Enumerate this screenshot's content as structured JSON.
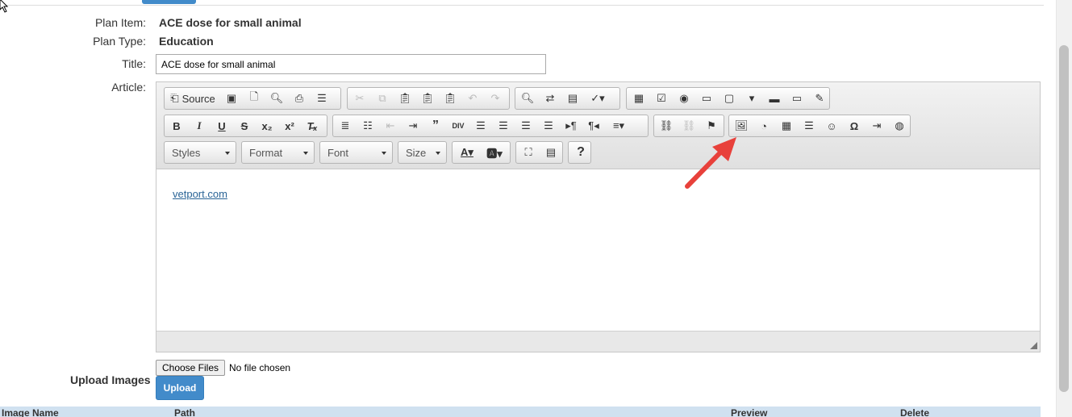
{
  "form": {
    "plan_item_label": "Plan Item:",
    "plan_item_value": "ACE dose for small animal",
    "plan_type_label": "Plan Type:",
    "plan_type_value": "Education",
    "title_label": "Title:",
    "title_value": "ACE dose for small animal",
    "article_label": "Article:"
  },
  "editor": {
    "source_label": "Source",
    "combos": {
      "styles": "Styles",
      "format": "Format",
      "font": "Font",
      "size": "Size"
    },
    "content_link": "vetport.com"
  },
  "upload": {
    "label": "Upload Images",
    "choose_label": "Choose Files",
    "no_file": "No file chosen",
    "upload_button": "Upload"
  },
  "table": {
    "headers": [
      "Image Name",
      "Path",
      "Preview",
      "Delete"
    ]
  },
  "colors": {
    "accent": "#428bca",
    "annotation_arrow": "#e8413b",
    "link": "#2a6496"
  }
}
